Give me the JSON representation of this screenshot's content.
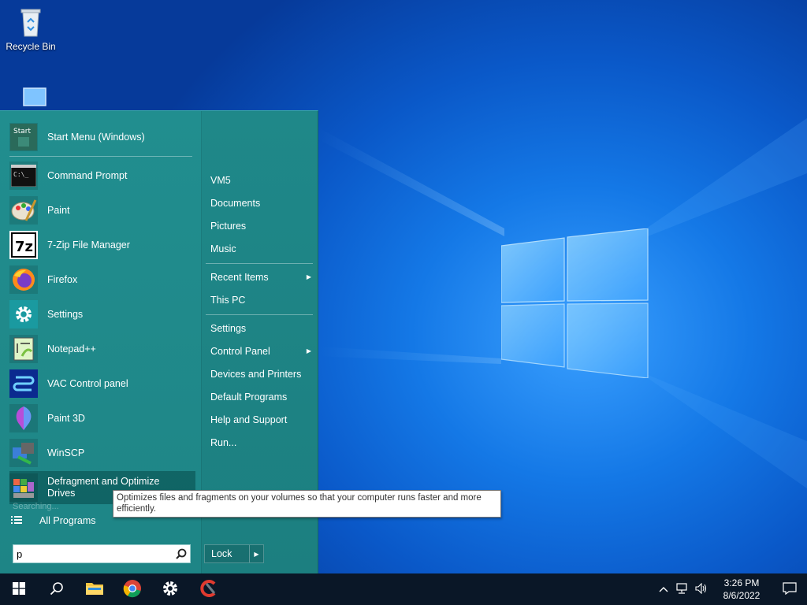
{
  "desktop": {
    "icons": [
      {
        "label": "Recycle Bin"
      },
      {
        "label": ""
      }
    ]
  },
  "start_menu": {
    "programs": [
      {
        "label": "Start Menu (Windows)",
        "icon": "start-menu-icon"
      },
      {
        "label": "Command Prompt",
        "icon": "command-prompt-icon"
      },
      {
        "label": "Paint",
        "icon": "paint-icon"
      },
      {
        "label": "7-Zip File Manager",
        "icon": "7zip-icon"
      },
      {
        "label": "Firefox",
        "icon": "firefox-icon"
      },
      {
        "label": "Settings",
        "icon": "gear-icon"
      },
      {
        "label": "Notepad++",
        "icon": "notepadpp-icon"
      },
      {
        "label": "VAC Control panel",
        "icon": "vac-icon"
      },
      {
        "label": "Paint 3D",
        "icon": "paint3d-icon"
      },
      {
        "label": "WinSCP",
        "icon": "winscp-icon"
      },
      {
        "label": "Defragment and Optimize Drives",
        "icon": "defrag-icon"
      }
    ],
    "start_icon_text": "Start",
    "cmd_icon_text": "C:\\_",
    "sevenzip_icon_text": "7z",
    "searching_text": "Searching...",
    "all_programs": "All Programs",
    "search_value": "p",
    "right_items": [
      {
        "label": "VM5"
      },
      {
        "label": "Documents"
      },
      {
        "label": "Pictures"
      },
      {
        "label": "Music"
      },
      {
        "label": "Recent Items",
        "submenu": true
      },
      {
        "label": "This PC"
      },
      {
        "label": "Settings"
      },
      {
        "label": "Control Panel",
        "submenu": true
      },
      {
        "label": "Devices and Printers"
      },
      {
        "label": "Default Programs"
      },
      {
        "label": "Help and Support"
      },
      {
        "label": "Run..."
      }
    ],
    "lock_label": "Lock",
    "tooltip": "Optimizes files and fragments on your volumes so that your computer runs faster and more efficiently."
  },
  "taskbar": {
    "pinned": [
      "windows-start-icon",
      "search-icon",
      "file-explorer-icon",
      "chrome-icon",
      "gear-icon",
      "ccleaner-icon"
    ],
    "time": "3:26 PM",
    "date": "8/6/2022"
  },
  "colors": {
    "menu_bg": "#1f8a8a",
    "taskbar_bg": "#0a1727",
    "desktop_blue": "#1478e6"
  }
}
